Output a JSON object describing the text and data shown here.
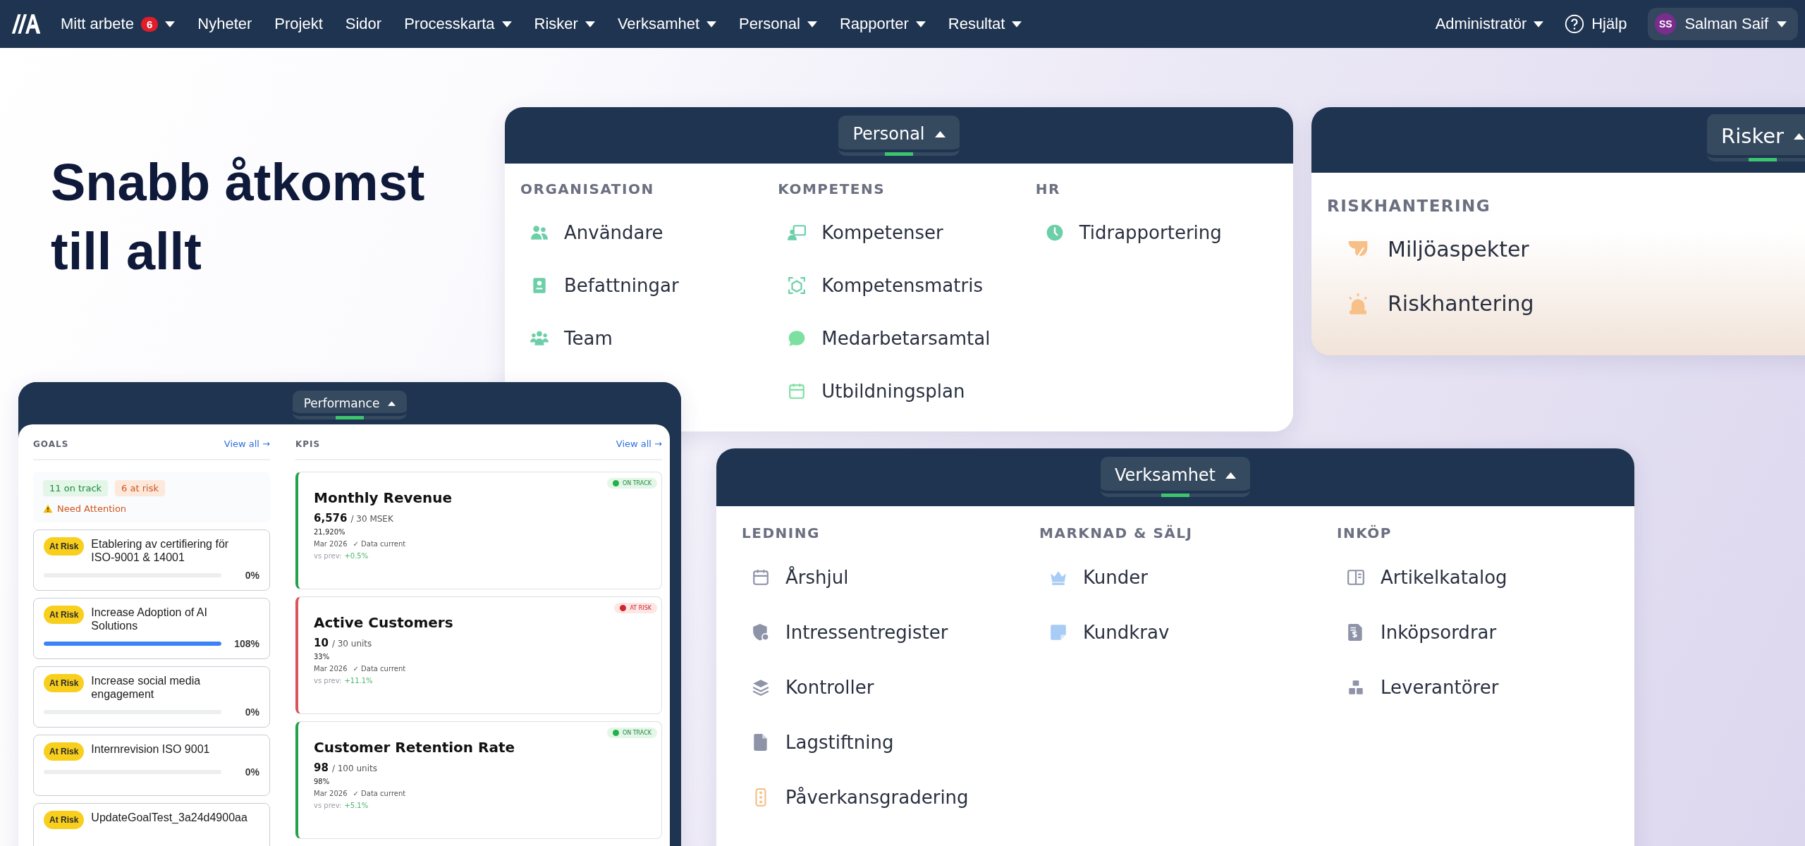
{
  "navbar": {
    "items": [
      {
        "label": "Mitt arbete",
        "badge": "6",
        "dropdown": true
      },
      {
        "label": "Nyheter",
        "dropdown": false
      },
      {
        "label": "Projekt",
        "dropdown": false
      },
      {
        "label": "Sidor",
        "dropdown": false
      },
      {
        "label": "Processkarta",
        "dropdown": true
      },
      {
        "label": "Risker",
        "dropdown": true
      },
      {
        "label": "Verksamhet",
        "dropdown": true
      },
      {
        "label": "Personal",
        "dropdown": true
      },
      {
        "label": "Rapporter",
        "dropdown": true
      },
      {
        "label": "Resultat",
        "dropdown": true
      }
    ],
    "role": {
      "label": "Administratör",
      "dropdown": true
    },
    "help": "Hjälp",
    "user": {
      "initials": "SS",
      "name": "Salman Saif",
      "dropdown": true
    }
  },
  "hero": {
    "title": "Snabb åtkomst till allt"
  },
  "menus": [
    {
      "title": "Personal",
      "open": true,
      "groups": [
        {
          "heading": "ORGANISATION",
          "items": [
            "Användare",
            "Befattningar",
            "Team"
          ]
        },
        {
          "heading": "KOMPETENS",
          "items": [
            "Kompetenser",
            "Kompetensmatris",
            "Medarbetarsamtal",
            "Utbildningsplan"
          ]
        },
        {
          "heading": "HR",
          "items": [
            "Tidrapportering"
          ]
        }
      ]
    },
    {
      "title": "Risker",
      "open": true,
      "groups": [
        {
          "heading": "RISKHANTERING",
          "items": [
            "Miljöaspekter",
            "Riskhantering"
          ]
        }
      ]
    },
    {
      "title": "Verksamhet",
      "open": true,
      "groups": [
        {
          "heading": "LEDNING",
          "items": [
            "Årshjul",
            "Intressentregister",
            "Kontroller",
            "Lagstiftning",
            "Påverkansgradering"
          ]
        },
        {
          "heading": "MARKNAD & SÄLJ",
          "items": [
            "Kunder",
            "Kundkrav"
          ]
        },
        {
          "heading": "INKÖP",
          "items": [
            "Artikelkatalog",
            "Inköpsordrar",
            "Leverantörer"
          ]
        }
      ]
    }
  ],
  "performance": {
    "title": "Performance",
    "open": true,
    "goals": {
      "heading": "GOALS",
      "link": "View all →",
      "on_track": "11 on track",
      "at_risk": "6 at risk",
      "attention": "Need Attention",
      "items": [
        {
          "badge": "At Risk",
          "title": "Etablering av certifiering för ISO-9001 & 14001",
          "level": 0,
          "percent": "0%"
        },
        {
          "badge": "At Risk",
          "title": "Increase Adoption of AI Solutions",
          "level": 1,
          "percent": "108%"
        },
        {
          "badge": "At Risk",
          "title": "Increase social media engagement",
          "level": 0,
          "percent": "0%"
        },
        {
          "badge": "At Risk",
          "title": "Internrevision ISO 9001",
          "level": 0,
          "percent": "0%"
        },
        {
          "badge": "At Risk",
          "title": "UpdateGoalTest_3a24d4900aa"
        }
      ]
    },
    "kpis": {
      "heading": "KPIS",
      "link": "View all →",
      "items": [
        {
          "kind": "on_track",
          "status_label": "ON TRACK",
          "title": "Monthly Revenue",
          "value": "6,576",
          "target": "/ 30 MSEK",
          "percent": "21,920%",
          "period": "Mar 2026",
          "freshness": "✓ Data current",
          "change_label": "vs prev:",
          "change": "+0.5%"
        },
        {
          "kind": "at_risk",
          "status_label": "AT RISK",
          "title": "Active Customers",
          "value": "10",
          "target": "/ 30 units",
          "percent": "33%",
          "period": "Mar 2026",
          "freshness": "✓ Data current",
          "change_label": "vs prev:",
          "change": "+11.1%"
        },
        {
          "kind": "on_track",
          "status_label": "ON TRACK",
          "title": "Customer Retention Rate",
          "value": "98",
          "target": "/ 100 units",
          "percent": "98%",
          "period": "Mar 2026",
          "freshness": "✓ Data current",
          "change_label": "vs prev:",
          "change": "+5.1%"
        }
      ]
    }
  }
}
